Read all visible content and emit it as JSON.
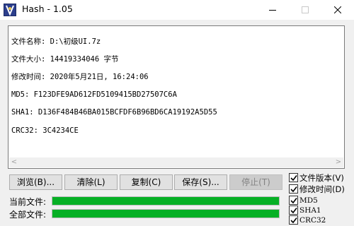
{
  "window": {
    "title": "Hash - 1.05"
  },
  "output": {
    "lines": [
      "文件名称: D:\\初级UI.7z",
      "文件大小: 14419334046 字节",
      "修改时间: 2020年5月21日, 16:24:06",
      "MD5: F123DFE9AD612FD5109415BD27507C6A",
      "SHA1: D136F484B46BA015BCFDF6B96BD6CA19192A5D55",
      "CRC32: 3C4234CE"
    ]
  },
  "buttons": {
    "browse": "浏览(B)...",
    "clear": "清除(L)",
    "copy": "复制(C)",
    "save": "保存(S)...",
    "stop": "停止(T)"
  },
  "progress": {
    "current_label": "当前文件:",
    "current_fraction": 1.0,
    "total_label": "全部文件:",
    "total_fraction": 1.0,
    "color": "#06b025"
  },
  "options": [
    {
      "label": "文件版本(V)",
      "checked": true
    },
    {
      "label": "修改时间(D)",
      "checked": true
    },
    {
      "label": "MD5",
      "checked": true
    },
    {
      "label": "SHA1",
      "checked": true
    },
    {
      "label": "CRC32",
      "checked": true
    }
  ]
}
